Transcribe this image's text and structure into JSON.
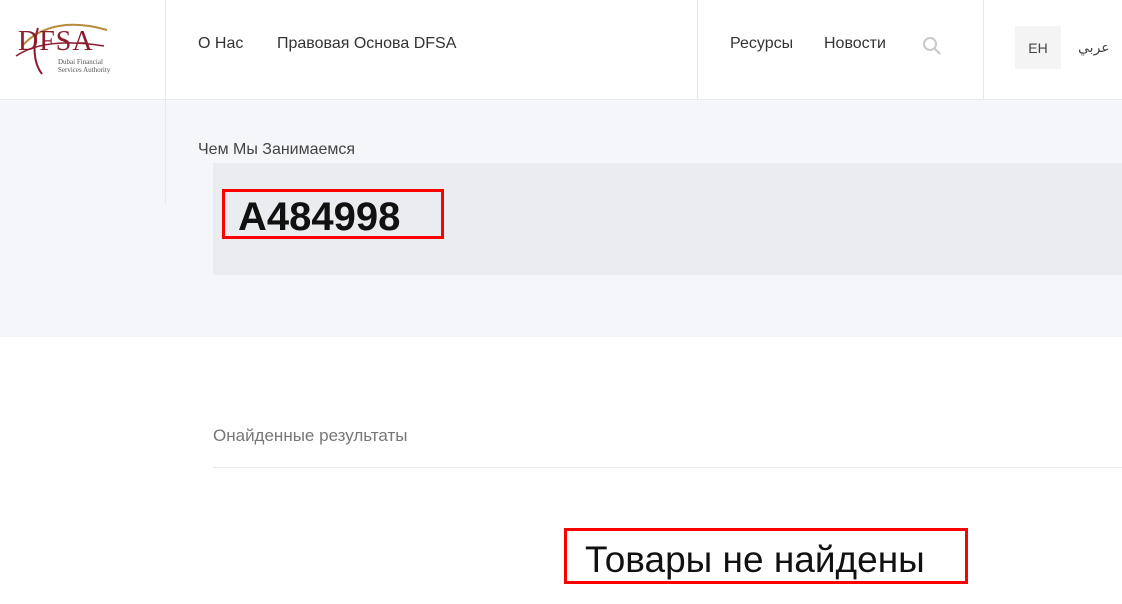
{
  "header": {
    "logo": {
      "mark": "DFSA",
      "sub": "Dubai Financial Services Authority",
      "colors": {
        "primary": "#8a1c2b",
        "accent": "#b88a3c"
      }
    },
    "nav_left": [
      {
        "label": "О Нас"
      },
      {
        "label": "Правовая Основа DFSA"
      }
    ],
    "nav_right": [
      {
        "label": "Ресурсы"
      },
      {
        "label": "Новости"
      }
    ],
    "search_icon": "search-icon",
    "lang_en": "EH",
    "lang_ar": "عربي"
  },
  "hero": {
    "breadcrumb": "Чем Мы Занимаемся",
    "search_term": "A484998"
  },
  "results": {
    "label": "Онайденные результаты",
    "empty_message": "Товары не найдены"
  },
  "colors": {
    "highlight_border": "#ff0000",
    "hero_bg": "#f5f6f9",
    "title_box_bg": "#ebecef"
  }
}
